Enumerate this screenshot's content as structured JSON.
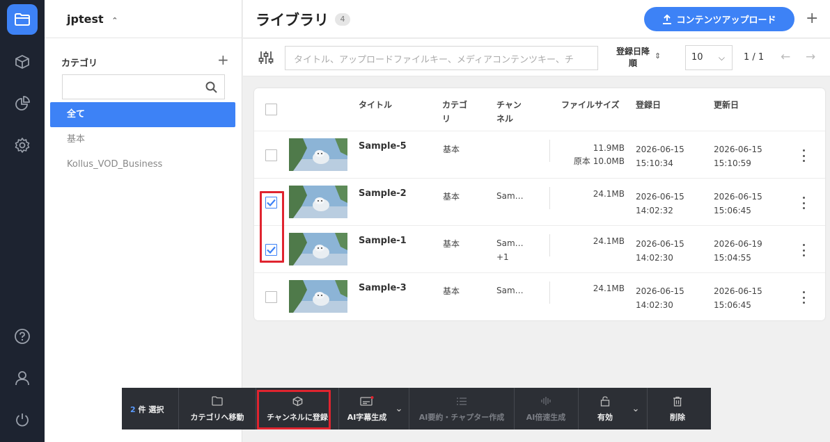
{
  "workspace": "jptest",
  "sidebar": {
    "category_heading": "カテゴリ",
    "categories": [
      {
        "label": "全て",
        "active": true
      },
      {
        "label": "基本",
        "active": false
      },
      {
        "label": "Kollus_VOD_Business",
        "active": false
      }
    ]
  },
  "header": {
    "title": "ライブラリ",
    "count": "4",
    "upload_label": "コンテンツアップロード"
  },
  "filter": {
    "search_placeholder": "タイトル、アップロードファイルキー、メディアコンテンツキー、チ",
    "sort_label": "登録日降順",
    "per_page": "10",
    "page": "1 / 1"
  },
  "table": {
    "columns": {
      "title": "タイトル",
      "category": "カテゴリ",
      "channel": "チャンネル",
      "filesize": "ファイルサイズ",
      "registered": "登録日",
      "updated": "更新日"
    },
    "rows": [
      {
        "title": "Sample-5",
        "category": "基本",
        "channel": "",
        "channel_extra": "",
        "size": "11.9MB",
        "size_original": "原本 10.0MB",
        "reg_date": "2026-06-15",
        "reg_time": "15:10:34",
        "upd_date": "2026-06-15",
        "upd_time": "15:10:59",
        "checked": false
      },
      {
        "title": "Sample-2",
        "category": "基本",
        "channel": "Sam…",
        "channel_extra": "",
        "size": "24.1MB",
        "size_original": "",
        "reg_date": "2026-06-15",
        "reg_time": "14:02:32",
        "upd_date": "2026-06-15",
        "upd_time": "15:06:45",
        "checked": true
      },
      {
        "title": "Sample-1",
        "category": "基本",
        "channel": "Sam…",
        "channel_extra": "+1",
        "size": "24.1MB",
        "size_original": "",
        "reg_date": "2026-06-15",
        "reg_time": "14:02:30",
        "upd_date": "2026-06-19",
        "upd_time": "15:04:55",
        "checked": true
      },
      {
        "title": "Sample-3",
        "category": "基本",
        "channel": "Sam…",
        "channel_extra": "",
        "size": "24.1MB",
        "size_original": "",
        "reg_date": "2026-06-15",
        "reg_time": "14:02:30",
        "upd_date": "2026-06-15",
        "upd_time": "15:06:45",
        "checked": false
      }
    ]
  },
  "action_bar": {
    "selected_count": "2",
    "selected_suffix": "件 選択",
    "move_category": "カテゴリへ移動",
    "register_channel": "チャンネルに登録",
    "ai_subtitle": "AI字幕生成",
    "ai_summary": "AI要約・チャプター作成",
    "ai_speed": "AI倍速生成",
    "enable": "有効",
    "delete": "削除"
  },
  "icons": [
    "folder-icon",
    "cube-icon",
    "pie-chart-icon",
    "gear-icon",
    "help-icon",
    "user-icon",
    "power-icon",
    "search-icon",
    "upload-icon",
    "plus-icon",
    "sliders-icon",
    "arrow-left-icon",
    "arrow-right-icon",
    "kebab-icon",
    "subtitle-icon",
    "list-icon",
    "waveform-icon",
    "unlock-icon",
    "trash-icon"
  ],
  "colors": {
    "accent": "#3d82f6",
    "rail": "#1d2330",
    "highlight": "#e0242f",
    "action_bar": "#2c2f35"
  }
}
